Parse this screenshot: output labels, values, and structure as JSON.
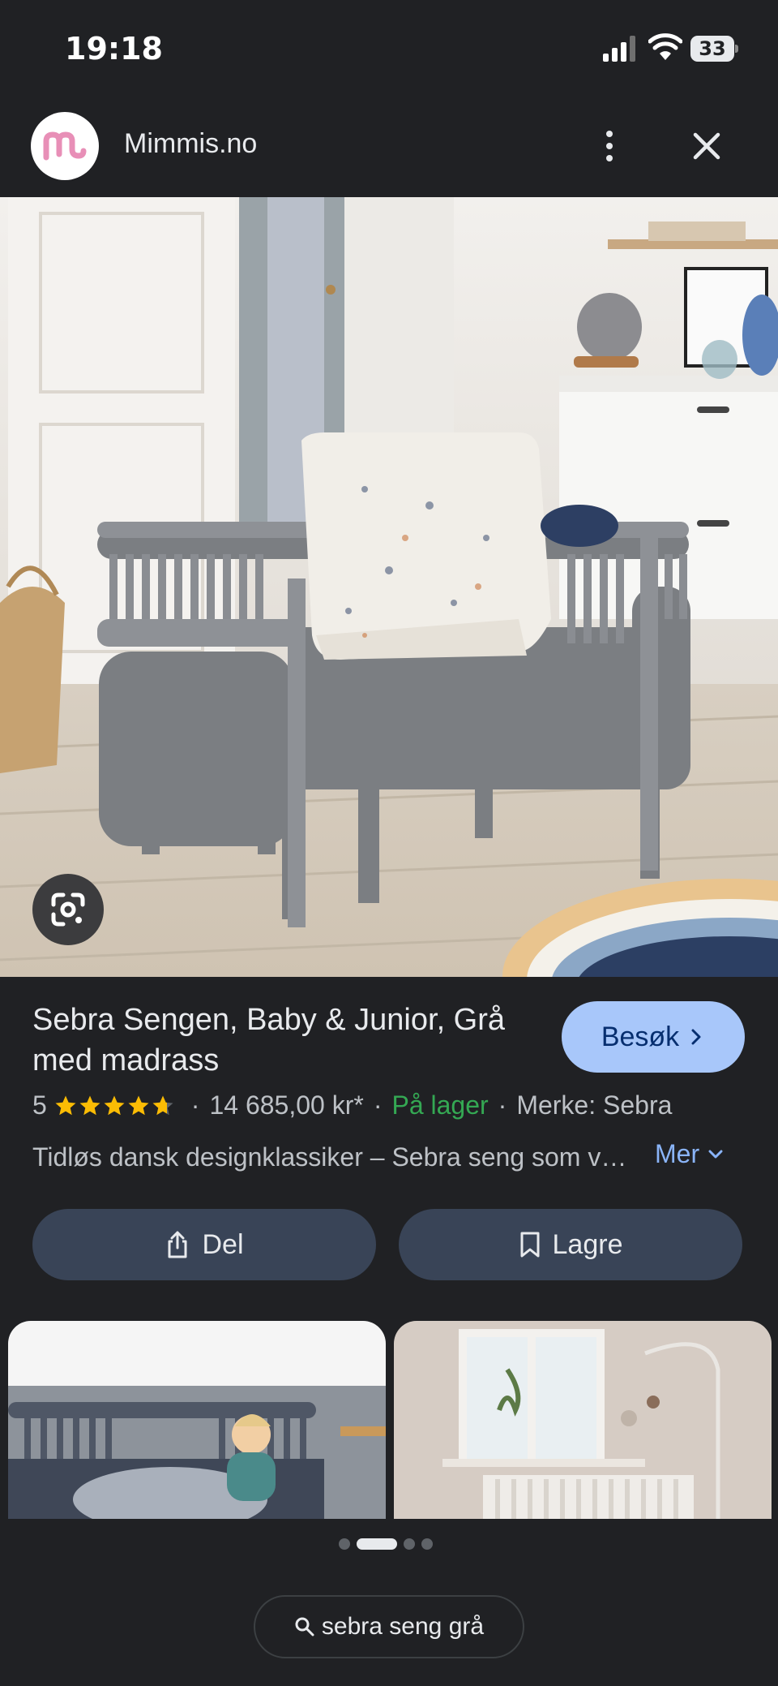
{
  "status_bar": {
    "time": "19:18",
    "battery": "33"
  },
  "header": {
    "site_name": "Mimmis.no",
    "logo_letter": "m"
  },
  "product": {
    "title": "Sebra Sengen, Baby & Junior, Grå med madrass",
    "visit_label": "Besøk",
    "rating": "5",
    "price": "14 685,00 kr*",
    "availability": "På lager",
    "brand": "Merke: Sebra",
    "description": "Tidløs dansk designklassiker – Sebra seng som vokser med barnet",
    "more_label": "Mer"
  },
  "actions": {
    "share_label": "Del",
    "save_label": "Lagre"
  },
  "search": {
    "query": "sebra seng grå"
  },
  "colors": {
    "accent": "#a8c7fa",
    "stock": "#34a853",
    "link": "#8ab4f8",
    "star": "#fbbc04",
    "chip": "#394457"
  }
}
